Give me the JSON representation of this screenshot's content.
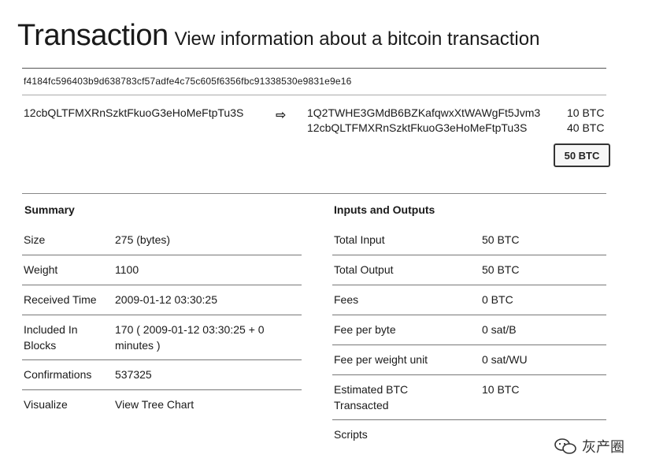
{
  "header": {
    "title": "Transaction",
    "subtitle": "View information about a bitcoin transaction"
  },
  "tx": {
    "hash": "f4184fc596403b9d638783cf57adfe4c75c605f6356fbc91338530e9831e9e16",
    "input_address": "12cbQLTFMXRnSzktFkuoG3eHoMeFtpTu3S",
    "outputs": [
      {
        "address": "1Q2TWHE3GMdB6BZKafqwxXtWAWgFt5Jvm3",
        "amount": "10 BTC"
      },
      {
        "address": "12cbQLTFMXRnSzktFkuoG3eHoMeFtpTu3S",
        "amount": "40 BTC"
      }
    ],
    "total_badge": "50 BTC"
  },
  "summary": {
    "title": "Summary",
    "rows": [
      {
        "label": "Size",
        "value": "275 (bytes)"
      },
      {
        "label": "Weight",
        "value": "1100"
      },
      {
        "label": "Received Time",
        "value": "2009-01-12 03:30:25"
      },
      {
        "label": "Included In Blocks",
        "value": "170 ( 2009-01-12 03:30:25 + 0 minutes )"
      },
      {
        "label": "Confirmations",
        "value": "537325"
      },
      {
        "label": "Visualize",
        "value": "View Tree Chart"
      }
    ]
  },
  "io": {
    "title": "Inputs and Outputs",
    "rows": [
      {
        "label": "Total Input",
        "value": "50 BTC"
      },
      {
        "label": "Total Output",
        "value": "50 BTC"
      },
      {
        "label": "Fees",
        "value": "0 BTC"
      },
      {
        "label": "Fee per byte",
        "value": "0 sat/B"
      },
      {
        "label": "Fee per weight unit",
        "value": "0 sat/WU"
      },
      {
        "label": "Estimated BTC Transacted",
        "value": "10 BTC"
      },
      {
        "label": "Scripts",
        "value": ""
      }
    ]
  },
  "watermark": {
    "text": "灰产圈",
    "icon": "wechat-icon"
  },
  "colors": {
    "text": "#1a1a1a",
    "rule": "#555555",
    "background": "#ffffff"
  }
}
